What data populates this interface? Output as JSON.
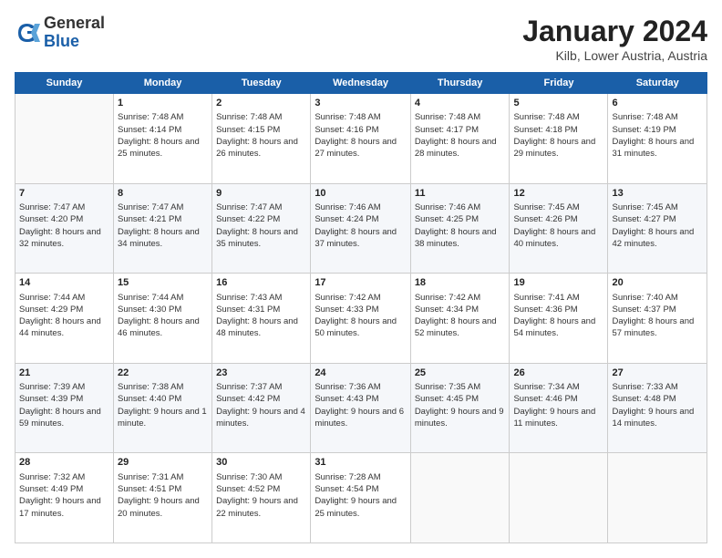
{
  "header": {
    "logo_general": "General",
    "logo_blue": "Blue",
    "title": "January 2024",
    "location": "Kilb, Lower Austria, Austria"
  },
  "days_of_week": [
    "Sunday",
    "Monday",
    "Tuesday",
    "Wednesday",
    "Thursday",
    "Friday",
    "Saturday"
  ],
  "weeks": [
    [
      {
        "day": "",
        "sunrise": "",
        "sunset": "",
        "daylight": "",
        "empty": true
      },
      {
        "day": "1",
        "sunrise": "Sunrise: 7:48 AM",
        "sunset": "Sunset: 4:14 PM",
        "daylight": "Daylight: 8 hours and 25 minutes."
      },
      {
        "day": "2",
        "sunrise": "Sunrise: 7:48 AM",
        "sunset": "Sunset: 4:15 PM",
        "daylight": "Daylight: 8 hours and 26 minutes."
      },
      {
        "day": "3",
        "sunrise": "Sunrise: 7:48 AM",
        "sunset": "Sunset: 4:16 PM",
        "daylight": "Daylight: 8 hours and 27 minutes."
      },
      {
        "day": "4",
        "sunrise": "Sunrise: 7:48 AM",
        "sunset": "Sunset: 4:17 PM",
        "daylight": "Daylight: 8 hours and 28 minutes."
      },
      {
        "day": "5",
        "sunrise": "Sunrise: 7:48 AM",
        "sunset": "Sunset: 4:18 PM",
        "daylight": "Daylight: 8 hours and 29 minutes."
      },
      {
        "day": "6",
        "sunrise": "Sunrise: 7:48 AM",
        "sunset": "Sunset: 4:19 PM",
        "daylight": "Daylight: 8 hours and 31 minutes."
      }
    ],
    [
      {
        "day": "7",
        "sunrise": "Sunrise: 7:47 AM",
        "sunset": "Sunset: 4:20 PM",
        "daylight": "Daylight: 8 hours and 32 minutes."
      },
      {
        "day": "8",
        "sunrise": "Sunrise: 7:47 AM",
        "sunset": "Sunset: 4:21 PM",
        "daylight": "Daylight: 8 hours and 34 minutes."
      },
      {
        "day": "9",
        "sunrise": "Sunrise: 7:47 AM",
        "sunset": "Sunset: 4:22 PM",
        "daylight": "Daylight: 8 hours and 35 minutes."
      },
      {
        "day": "10",
        "sunrise": "Sunrise: 7:46 AM",
        "sunset": "Sunset: 4:24 PM",
        "daylight": "Daylight: 8 hours and 37 minutes."
      },
      {
        "day": "11",
        "sunrise": "Sunrise: 7:46 AM",
        "sunset": "Sunset: 4:25 PM",
        "daylight": "Daylight: 8 hours and 38 minutes."
      },
      {
        "day": "12",
        "sunrise": "Sunrise: 7:45 AM",
        "sunset": "Sunset: 4:26 PM",
        "daylight": "Daylight: 8 hours and 40 minutes."
      },
      {
        "day": "13",
        "sunrise": "Sunrise: 7:45 AM",
        "sunset": "Sunset: 4:27 PM",
        "daylight": "Daylight: 8 hours and 42 minutes."
      }
    ],
    [
      {
        "day": "14",
        "sunrise": "Sunrise: 7:44 AM",
        "sunset": "Sunset: 4:29 PM",
        "daylight": "Daylight: 8 hours and 44 minutes."
      },
      {
        "day": "15",
        "sunrise": "Sunrise: 7:44 AM",
        "sunset": "Sunset: 4:30 PM",
        "daylight": "Daylight: 8 hours and 46 minutes."
      },
      {
        "day": "16",
        "sunrise": "Sunrise: 7:43 AM",
        "sunset": "Sunset: 4:31 PM",
        "daylight": "Daylight: 8 hours and 48 minutes."
      },
      {
        "day": "17",
        "sunrise": "Sunrise: 7:42 AM",
        "sunset": "Sunset: 4:33 PM",
        "daylight": "Daylight: 8 hours and 50 minutes."
      },
      {
        "day": "18",
        "sunrise": "Sunrise: 7:42 AM",
        "sunset": "Sunset: 4:34 PM",
        "daylight": "Daylight: 8 hours and 52 minutes."
      },
      {
        "day": "19",
        "sunrise": "Sunrise: 7:41 AM",
        "sunset": "Sunset: 4:36 PM",
        "daylight": "Daylight: 8 hours and 54 minutes."
      },
      {
        "day": "20",
        "sunrise": "Sunrise: 7:40 AM",
        "sunset": "Sunset: 4:37 PM",
        "daylight": "Daylight: 8 hours and 57 minutes."
      }
    ],
    [
      {
        "day": "21",
        "sunrise": "Sunrise: 7:39 AM",
        "sunset": "Sunset: 4:39 PM",
        "daylight": "Daylight: 8 hours and 59 minutes."
      },
      {
        "day": "22",
        "sunrise": "Sunrise: 7:38 AM",
        "sunset": "Sunset: 4:40 PM",
        "daylight": "Daylight: 9 hours and 1 minute."
      },
      {
        "day": "23",
        "sunrise": "Sunrise: 7:37 AM",
        "sunset": "Sunset: 4:42 PM",
        "daylight": "Daylight: 9 hours and 4 minutes."
      },
      {
        "day": "24",
        "sunrise": "Sunrise: 7:36 AM",
        "sunset": "Sunset: 4:43 PM",
        "daylight": "Daylight: 9 hours and 6 minutes."
      },
      {
        "day": "25",
        "sunrise": "Sunrise: 7:35 AM",
        "sunset": "Sunset: 4:45 PM",
        "daylight": "Daylight: 9 hours and 9 minutes."
      },
      {
        "day": "26",
        "sunrise": "Sunrise: 7:34 AM",
        "sunset": "Sunset: 4:46 PM",
        "daylight": "Daylight: 9 hours and 11 minutes."
      },
      {
        "day": "27",
        "sunrise": "Sunrise: 7:33 AM",
        "sunset": "Sunset: 4:48 PM",
        "daylight": "Daylight: 9 hours and 14 minutes."
      }
    ],
    [
      {
        "day": "28",
        "sunrise": "Sunrise: 7:32 AM",
        "sunset": "Sunset: 4:49 PM",
        "daylight": "Daylight: 9 hours and 17 minutes."
      },
      {
        "day": "29",
        "sunrise": "Sunrise: 7:31 AM",
        "sunset": "Sunset: 4:51 PM",
        "daylight": "Daylight: 9 hours and 20 minutes."
      },
      {
        "day": "30",
        "sunrise": "Sunrise: 7:30 AM",
        "sunset": "Sunset: 4:52 PM",
        "daylight": "Daylight: 9 hours and 22 minutes."
      },
      {
        "day": "31",
        "sunrise": "Sunrise: 7:28 AM",
        "sunset": "Sunset: 4:54 PM",
        "daylight": "Daylight: 9 hours and 25 minutes."
      },
      {
        "day": "",
        "sunrise": "",
        "sunset": "",
        "daylight": "",
        "empty": true
      },
      {
        "day": "",
        "sunrise": "",
        "sunset": "",
        "daylight": "",
        "empty": true
      },
      {
        "day": "",
        "sunrise": "",
        "sunset": "",
        "daylight": "",
        "empty": true
      }
    ]
  ]
}
